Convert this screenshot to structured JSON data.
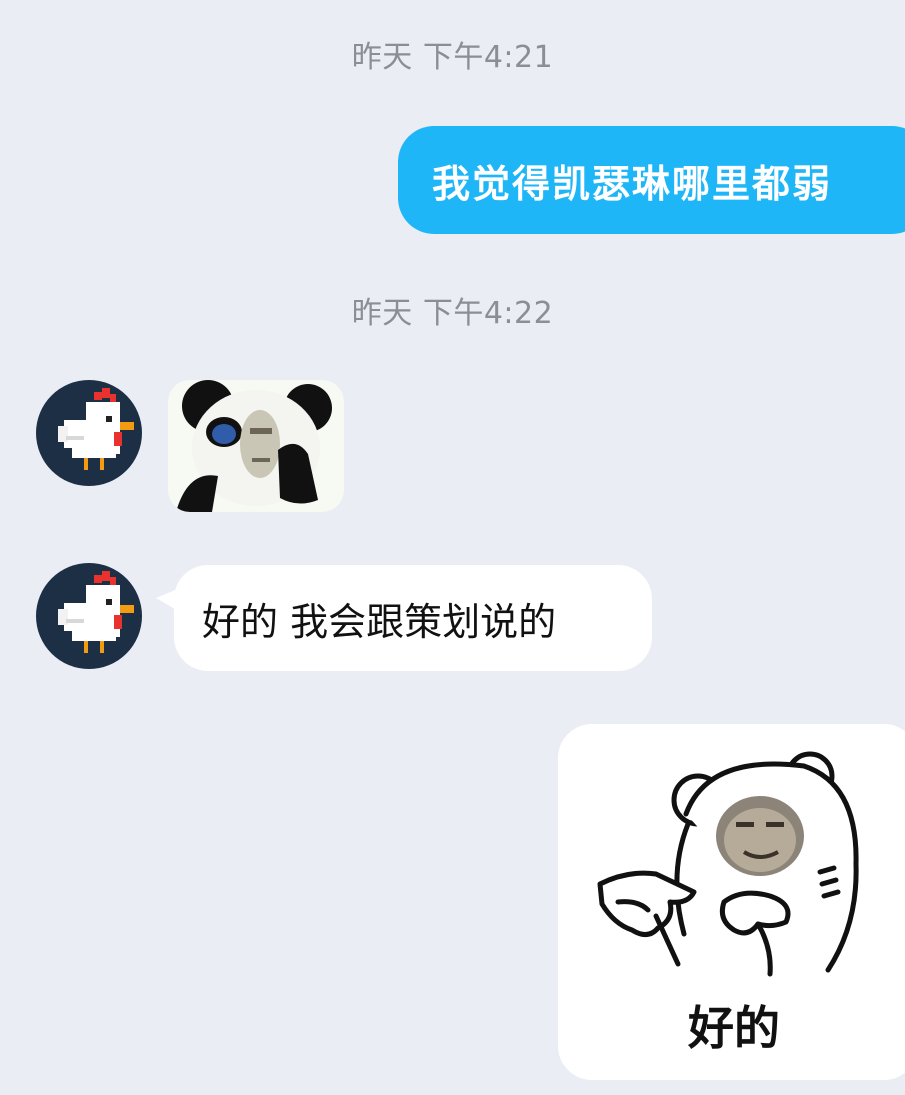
{
  "messages": {
    "timestamp_1": "昨天 下午4:21",
    "sent_text": "我觉得凯瑟琳哪里都弱",
    "timestamp_2": "昨天 下午4:22",
    "received_text": "好的 我会跟策划说的",
    "bear_sticker_caption": "好的"
  },
  "icons": {
    "avatar": "pixel-chicken-avatar",
    "sticker_1": "panda-face-meme-sticker",
    "sticker_2": "pointing-bear-meme-sticker"
  },
  "colors": {
    "background": "#eaedf4",
    "sent_bubble": "#1fb6f8",
    "received_bubble": "#ffffff",
    "timestamp_text": "#8a8e96"
  }
}
